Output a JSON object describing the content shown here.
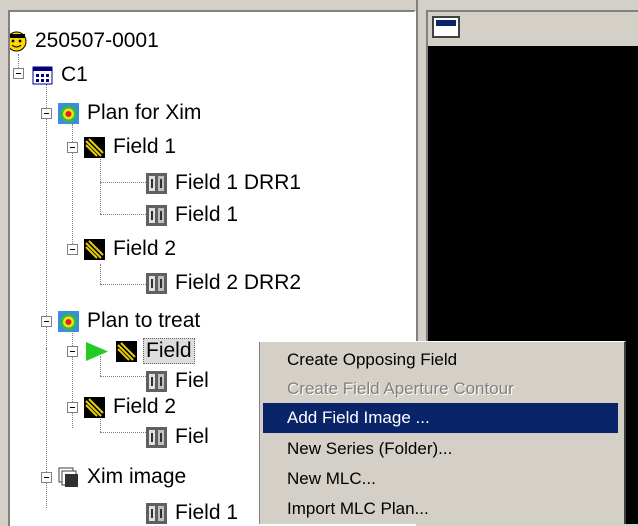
{
  "tree": {
    "patient_id": "250507-0001",
    "course": "C1",
    "plans": [
      {
        "label": "Plan for Xim",
        "fields": [
          {
            "label": "Field 1",
            "images": [
              "Field 1 DRR1",
              "Field 1"
            ]
          },
          {
            "label": "Field 2",
            "images": [
              "Field 2 DRR2"
            ]
          }
        ]
      },
      {
        "label": "Plan to treat",
        "fields": [
          {
            "label": "Field",
            "images": [
              "Fiel"
            ]
          },
          {
            "label": "Field 2",
            "images": [
              "Fiel"
            ]
          }
        ]
      }
    ],
    "xim_images": {
      "label": "Xim image",
      "items": [
        "Field 1"
      ]
    }
  },
  "context_menu": {
    "items": [
      {
        "label": "Create Opposing Field",
        "disabled": false
      },
      {
        "label": "Create Field Aperture Contour",
        "disabled": true
      },
      {
        "label": "Add Field Image ...",
        "highlighted": true
      },
      {
        "label": "New Series (Folder)..."
      },
      {
        "label": "New MLC..."
      },
      {
        "label": "Import MLC Plan..."
      }
    ]
  },
  "colors": {
    "menu_highlight": "#0a246a",
    "arrow": "#22cc22"
  }
}
